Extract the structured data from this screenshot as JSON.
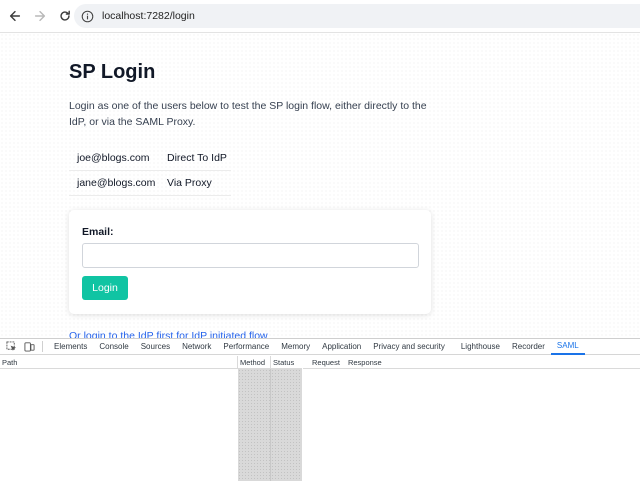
{
  "browser": {
    "url": "localhost:7282/login"
  },
  "page": {
    "title": "SP Login",
    "intro": "Login as one of the users below to test the SP login flow, either directly to the IdP, or via the SAML Proxy.",
    "users": [
      {
        "email": "joe@blogs.com",
        "mode": "Direct To IdP"
      },
      {
        "email": "jane@blogs.com",
        "mode": "Via Proxy"
      }
    ],
    "form": {
      "email_label": "Email:",
      "email_value": "",
      "login_label": "Login"
    },
    "idp_link": "Or login to the IdP first for IdP initiated flow"
  },
  "devtools": {
    "tabs": [
      "Elements",
      "Console",
      "Sources",
      "Network",
      "Performance",
      "Memory",
      "Application",
      "Privacy and security",
      "Lighthouse",
      "Recorder",
      "SAML"
    ],
    "active_tab": "SAML",
    "columns": {
      "path": "Path",
      "method": "Method",
      "status": "Status"
    },
    "detail_tabs": {
      "request": "Request",
      "response": "Response"
    }
  },
  "colors": {
    "accent_button": "#10c4a3",
    "link": "#2563eb",
    "devtools_active": "#1a73e8"
  }
}
